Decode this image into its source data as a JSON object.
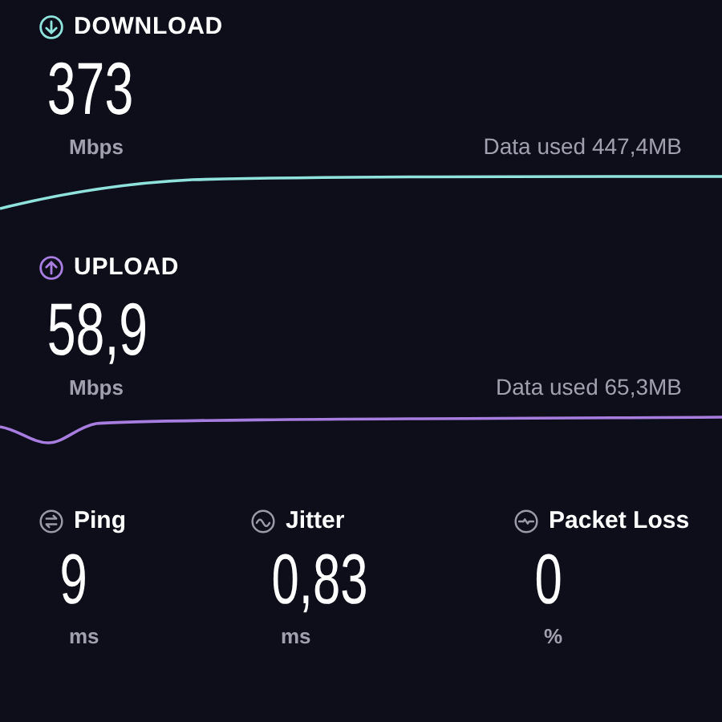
{
  "speeds": [
    {
      "kind": "download",
      "title": "DOWNLOAD",
      "value": "373",
      "unit": "Mbps",
      "data_used": "Data used 447,4MB"
    },
    {
      "kind": "upload",
      "title": "UPLOAD",
      "value": "58,9",
      "unit": "Mbps",
      "data_used": "Data used 65,3MB"
    }
  ],
  "metrics": [
    {
      "kind": "ping",
      "label": "Ping",
      "value": "9",
      "unit": "ms"
    },
    {
      "kind": "jitter",
      "label": "Jitter",
      "value": "0,83",
      "unit": "ms"
    },
    {
      "kind": "packet_loss",
      "label": "Packet Loss",
      "value": "0",
      "unit": "%"
    }
  ]
}
